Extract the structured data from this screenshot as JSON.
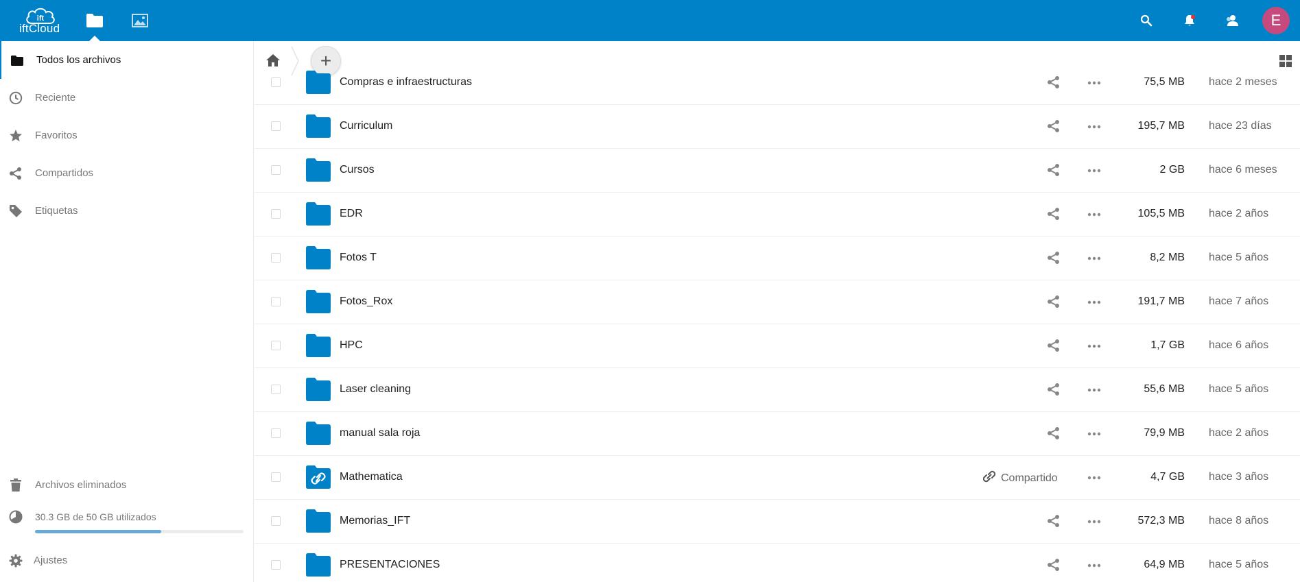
{
  "header": {
    "logo_text": "iftCloud",
    "logo_badge": "ift",
    "avatar_letter": "E",
    "brand_color": "#0082c9",
    "avatar_color": "#c64a7d"
  },
  "sidebar": {
    "items": [
      {
        "label": "Todos los archivos",
        "icon": "folder-icon",
        "active": true
      },
      {
        "label": "Reciente",
        "icon": "clock-icon"
      },
      {
        "label": "Favoritos",
        "icon": "star-icon"
      },
      {
        "label": "Compartidos",
        "icon": "share-icon"
      },
      {
        "label": "Etiquetas",
        "icon": "tag-icon"
      }
    ],
    "trash_label": "Archivos eliminados",
    "quota_label": "30.3 GB de 50 GB utilizados",
    "quota_fraction": 0.606,
    "settings_label": "Ajustes"
  },
  "controls": {
    "new_label": "+"
  },
  "files": [
    {
      "name": "Compras e infraestructuras",
      "size": "75,5 MB",
      "modified": "hace 2 meses",
      "shared": false
    },
    {
      "name": "Curriculum",
      "size": "195,7 MB",
      "modified": "hace 23 días",
      "shared": false
    },
    {
      "name": "Cursos",
      "size": "2 GB",
      "modified": "hace 6 meses",
      "shared": false
    },
    {
      "name": "EDR",
      "size": "105,5 MB",
      "modified": "hace 2 años",
      "shared": false
    },
    {
      "name": "Fotos T",
      "size": "8,2 MB",
      "modified": "hace 5 años",
      "shared": false
    },
    {
      "name": "Fotos_Rox",
      "size": "191,7 MB",
      "modified": "hace 7 años",
      "shared": false
    },
    {
      "name": "HPC",
      "size": "1,7 GB",
      "modified": "hace 6 años",
      "shared": false
    },
    {
      "name": "Laser cleaning",
      "size": "55,6 MB",
      "modified": "hace 5 años",
      "shared": false
    },
    {
      "name": "manual sala roja",
      "size": "79,9 MB",
      "modified": "hace 2 años",
      "shared": false
    },
    {
      "name": "Mathematica",
      "size": "4,7 GB",
      "modified": "hace 3 años",
      "shared": true,
      "shared_label": "Compartido"
    },
    {
      "name": "Memorias_IFT",
      "size": "572,3 MB",
      "modified": "hace 8 años",
      "shared": false
    },
    {
      "name": "PRESENTACIONES",
      "size": "64,9 MB",
      "modified": "hace 5 años",
      "shared": false
    }
  ]
}
